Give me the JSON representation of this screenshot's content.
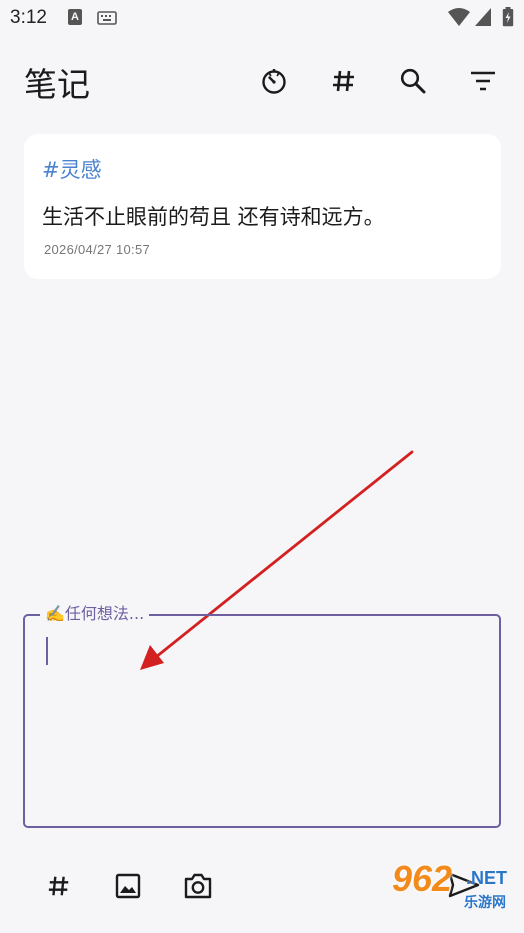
{
  "status_bar": {
    "time": "3:12",
    "notification_icon": "A"
  },
  "header": {
    "title": "笔记",
    "icons": [
      "timer-icon",
      "hashtag-icon",
      "search-icon",
      "filter-icon"
    ]
  },
  "note": {
    "tag": "#灵感",
    "content": "生活不止眼前的苟且 还有诗和远方。",
    "timestamp": "2026/04/27 10:57"
  },
  "composer": {
    "label": "✍️任何想法...",
    "value": ""
  },
  "bottom_bar": {
    "icons": [
      "hashtag-icon",
      "image-icon",
      "camera-icon",
      "send-icon"
    ]
  },
  "watermark": {
    "number": "962",
    "domain": ".NET",
    "site_name": "乐游网"
  },
  "colors": {
    "background": "#f6f6f9",
    "tag": "#4a82d0",
    "accent": "#6e5fa0",
    "annotation_arrow": "#d32020"
  }
}
